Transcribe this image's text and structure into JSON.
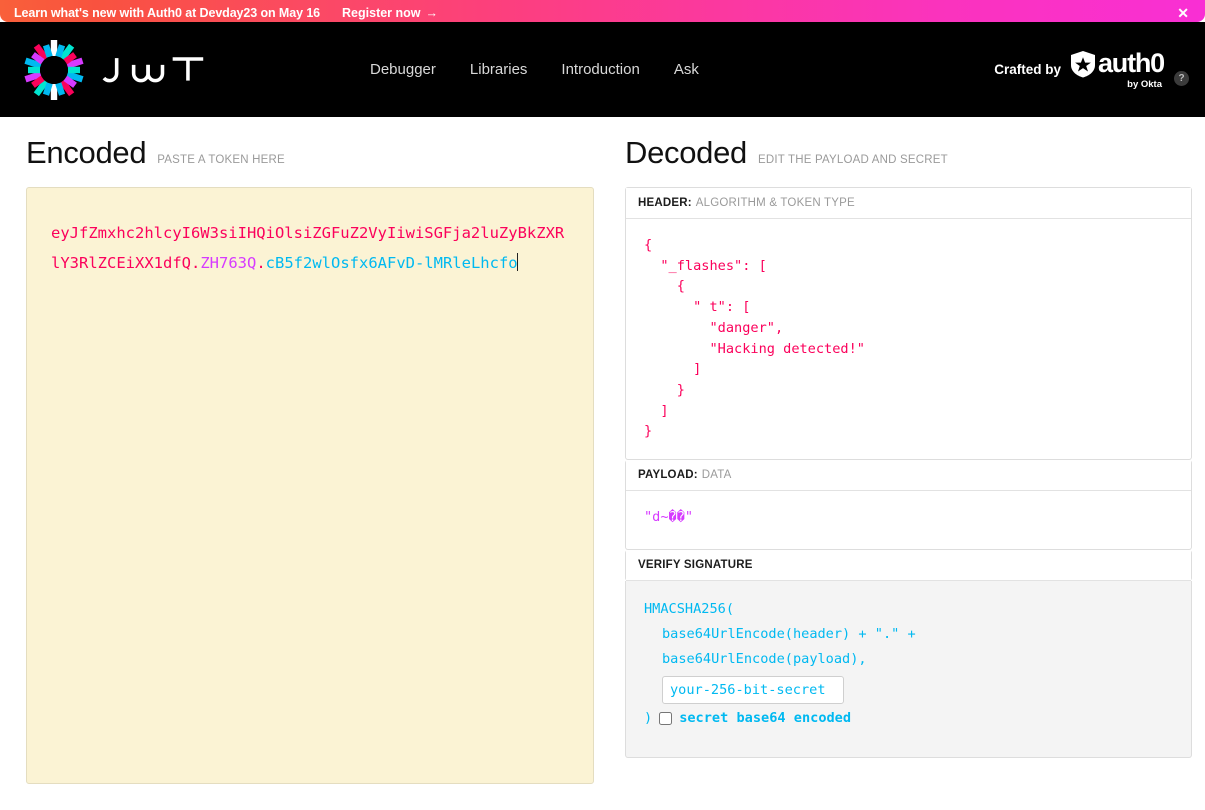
{
  "banner": {
    "text": "Learn what's new with Auth0 at Devday23 on May 16",
    "cta": "Register now",
    "cta_arrow": "→",
    "close": "✕",
    "gradient_from": "#f9603a",
    "gradient_to": "#f92fd4"
  },
  "nav": {
    "brand_name": "JWT",
    "links": [
      {
        "label": "Debugger"
      },
      {
        "label": "Libraries"
      },
      {
        "label": "Introduction"
      },
      {
        "label": "Ask"
      }
    ],
    "crafted_by": "Crafted by",
    "auth0_word": "auth0",
    "by_okta": "by Okta",
    "help": "?"
  },
  "encoded": {
    "title": "Encoded",
    "subtitle": "PASTE A TOKEN HERE",
    "token_header": "eyJfZmxhc2hlcyI6W3siIHQiOlsiZGFuZ2VyIiwiSGFja2luZyBkZXRlY3RlZCEiXX1dfQ",
    "token_payload": "ZH763Q",
    "token_signature": "cB5f2wlOsfx6AFvD-lMRleLhcfo",
    "separator": ".",
    "colors": {
      "header": "#fb015b",
      "payload": "#d63aff",
      "signature": "#00b9f1",
      "background": "#fbf3d4"
    }
  },
  "decoded": {
    "title": "Decoded",
    "subtitle": "EDIT THE PAYLOAD AND SECRET",
    "header_panel": {
      "label_key": "HEADER:",
      "label_value": "ALGORITHM & TOKEN TYPE",
      "json": "{\n  \"_flashes\": [\n    {\n      \" t\": [\n        \"danger\",\n        \"Hacking detected!\"\n      ]\n    }\n  ]\n}"
    },
    "payload_panel": {
      "label_key": "PAYLOAD:",
      "label_value": "DATA",
      "json": "\"d~��\""
    },
    "signature_panel": {
      "label_key": "VERIFY SIGNATURE",
      "label_value": "",
      "line1": "HMACSHA256(",
      "line2": "base64UrlEncode(header) + \".\" +",
      "line3": "base64UrlEncode(payload),",
      "secret_placeholder": "your-256-bit-secret",
      "secret_value": "",
      "closing_paren": ")",
      "base64_label": "secret base64 encoded",
      "base64_checked": false
    }
  }
}
